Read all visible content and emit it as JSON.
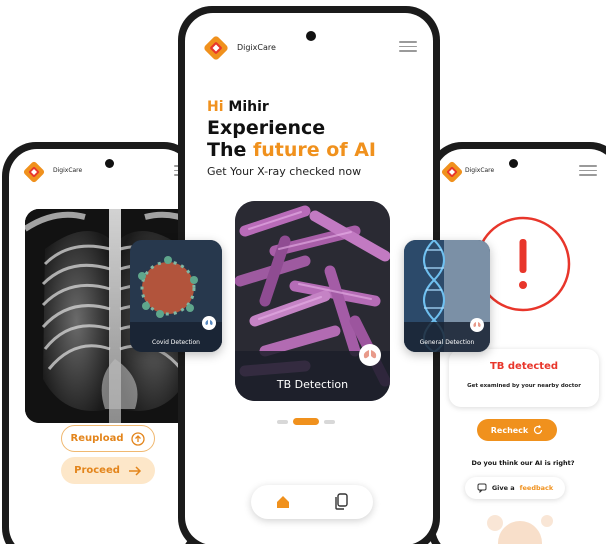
{
  "brand": {
    "name": "DigixCare",
    "accent": "#f0911d",
    "alert": "#e8362b"
  },
  "center_screen": {
    "greeting_hi": "Hi",
    "greeting_name": "Mihir",
    "headline_line1": "Experience",
    "headline_the": "The",
    "headline_accent": "future of AI",
    "subheadline": "Get Your X-ray checked now",
    "featured_card_label": "TB Detection",
    "carousel": {
      "total": 3,
      "active": 2
    }
  },
  "side_cards": {
    "left_label": "Covid Detection",
    "right_label": "General Detection"
  },
  "left_screen": {
    "reupload_label": "Reupload",
    "proceed_label": "Proceed"
  },
  "right_screen": {
    "result_title": "TB detected",
    "result_advice": "Get examined by your nearby doctor",
    "recheck_label": "Recheck",
    "feedback_question": "Do you think our AI is right?",
    "feedback_prefix": "Give a",
    "feedback_accent": "feedback"
  },
  "icons": [
    "logo-icon",
    "menu-icon",
    "upload-icon",
    "arrow-right-icon",
    "refresh-icon",
    "home-icon",
    "history-icon",
    "chat-icon",
    "lungs-icon"
  ]
}
